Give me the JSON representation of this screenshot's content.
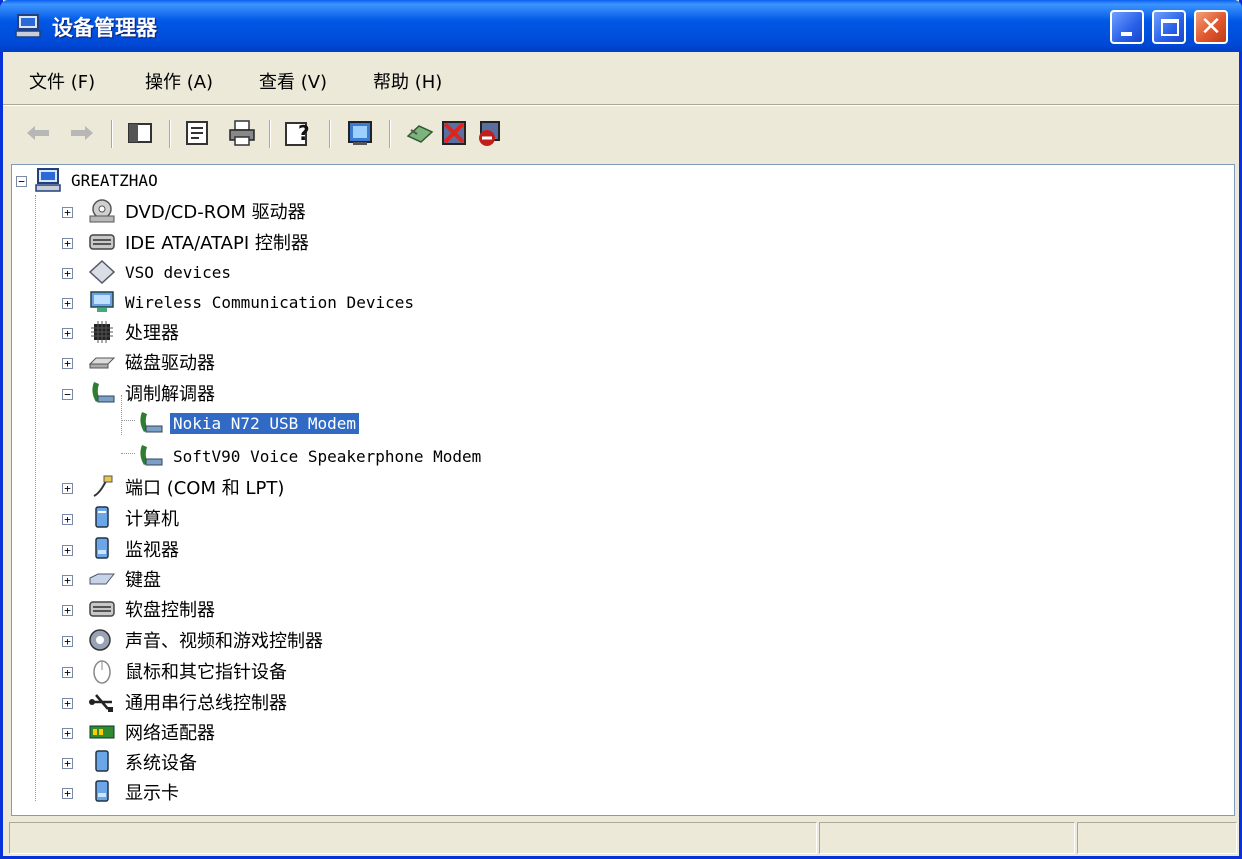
{
  "window": {
    "title": "设备管理器"
  },
  "menu": [
    {
      "label": "文件 (F)"
    },
    {
      "label": "操作 (A)"
    },
    {
      "label": "查看 (V)"
    },
    {
      "label": "帮助 (H)"
    }
  ],
  "toolbar": {
    "items": [
      "back-icon",
      "forward-icon",
      "show-hide-tree-icon",
      "properties-icon",
      "print-icon",
      "help-icon",
      "scan-hardware-icon",
      "update-driver-icon",
      "uninstall-icon",
      "disable-icon"
    ]
  },
  "tree": {
    "root": "GREATZHAO",
    "items": [
      {
        "label": "DVD/CD-ROM 驱动器",
        "icon": "dvd-drive-icon",
        "expanded": false
      },
      {
        "label": "IDE ATA/ATAPI 控制器",
        "icon": "ide-controller-icon",
        "expanded": false
      },
      {
        "label": "VSO devices",
        "icon": "vso-device-icon",
        "expanded": false
      },
      {
        "label": "Wireless Communication Devices",
        "icon": "wireless-device-icon",
        "expanded": false
      },
      {
        "label": "处理器",
        "icon": "processor-icon",
        "expanded": false
      },
      {
        "label": "磁盘驱动器",
        "icon": "disk-drive-icon",
        "expanded": false
      },
      {
        "label": "调制解调器",
        "icon": "modem-icon",
        "expanded": true,
        "children": [
          {
            "label": "Nokia N72 USB Modem",
            "icon": "modem-icon",
            "selected": true
          },
          {
            "label": "SoftV90 Voice Speakerphone Modem",
            "icon": "modem-icon",
            "selected": false
          }
        ]
      },
      {
        "label": "端口 (COM 和 LPT)",
        "icon": "port-icon",
        "expanded": false
      },
      {
        "label": "计算机",
        "icon": "computer-icon",
        "expanded": false
      },
      {
        "label": "监视器",
        "icon": "monitor-icon",
        "expanded": false
      },
      {
        "label": "键盘",
        "icon": "keyboard-icon",
        "expanded": false
      },
      {
        "label": "软盘控制器",
        "icon": "floppy-controller-icon",
        "expanded": false
      },
      {
        "label": "声音、视频和游戏控制器",
        "icon": "sound-icon",
        "expanded": false
      },
      {
        "label": "鼠标和其它指针设备",
        "icon": "mouse-icon",
        "expanded": false
      },
      {
        "label": "通用串行总线控制器",
        "icon": "usb-icon",
        "expanded": false
      },
      {
        "label": "网络适配器",
        "icon": "network-adapter-icon",
        "expanded": false
      },
      {
        "label": "系统设备",
        "icon": "system-device-icon",
        "expanded": false
      },
      {
        "label": "显示卡",
        "icon": "display-adapter-icon",
        "expanded": false
      }
    ]
  },
  "status": {
    "cells": [
      "",
      "",
      ""
    ]
  }
}
